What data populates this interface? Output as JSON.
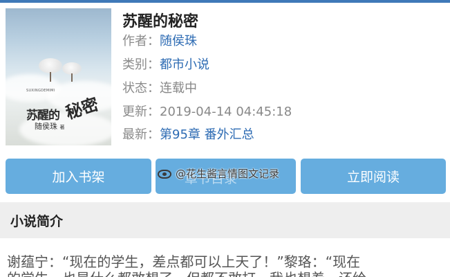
{
  "book": {
    "title": "苏醒的秘密",
    "cover": {
      "small_text": "SUXINGDEMIMI",
      "title_part1": "苏醒的",
      "title_part2": "秘密",
      "author": "随侯珠",
      "author_suffix": "著"
    },
    "info": [
      {
        "label": "作者：",
        "value": "随侯珠",
        "style": "link"
      },
      {
        "label": "类别：",
        "value": "都市小说",
        "style": "link"
      },
      {
        "label": "状态：",
        "value": "连载中",
        "style": "plain"
      },
      {
        "label": "更新：",
        "value": "2019-04-14 04:45:18",
        "style": "plain"
      },
      {
        "label": "最新：",
        "value": "第95章 番外汇总",
        "style": "link"
      }
    ]
  },
  "actions": {
    "add_shelf": "加入书架",
    "middle_hidden": "章节目录",
    "read_now": "立即阅读"
  },
  "watermark": {
    "text": "@花生酱言情图文记录",
    "icon": "weibo-icon"
  },
  "intro": {
    "header": "小说简介",
    "line1": "谢蕴宁：“现在的学生，差点都可以上天了！”黎珞：“现在",
    "line2_partial": "的学生，也是什么都敢想了。但都不敢打，我也想着，还给"
  },
  "colors": {
    "accent": "#3f79b8",
    "button": "#66addf",
    "link": "#2d6bb3",
    "section_bg": "#eeeeee"
  }
}
